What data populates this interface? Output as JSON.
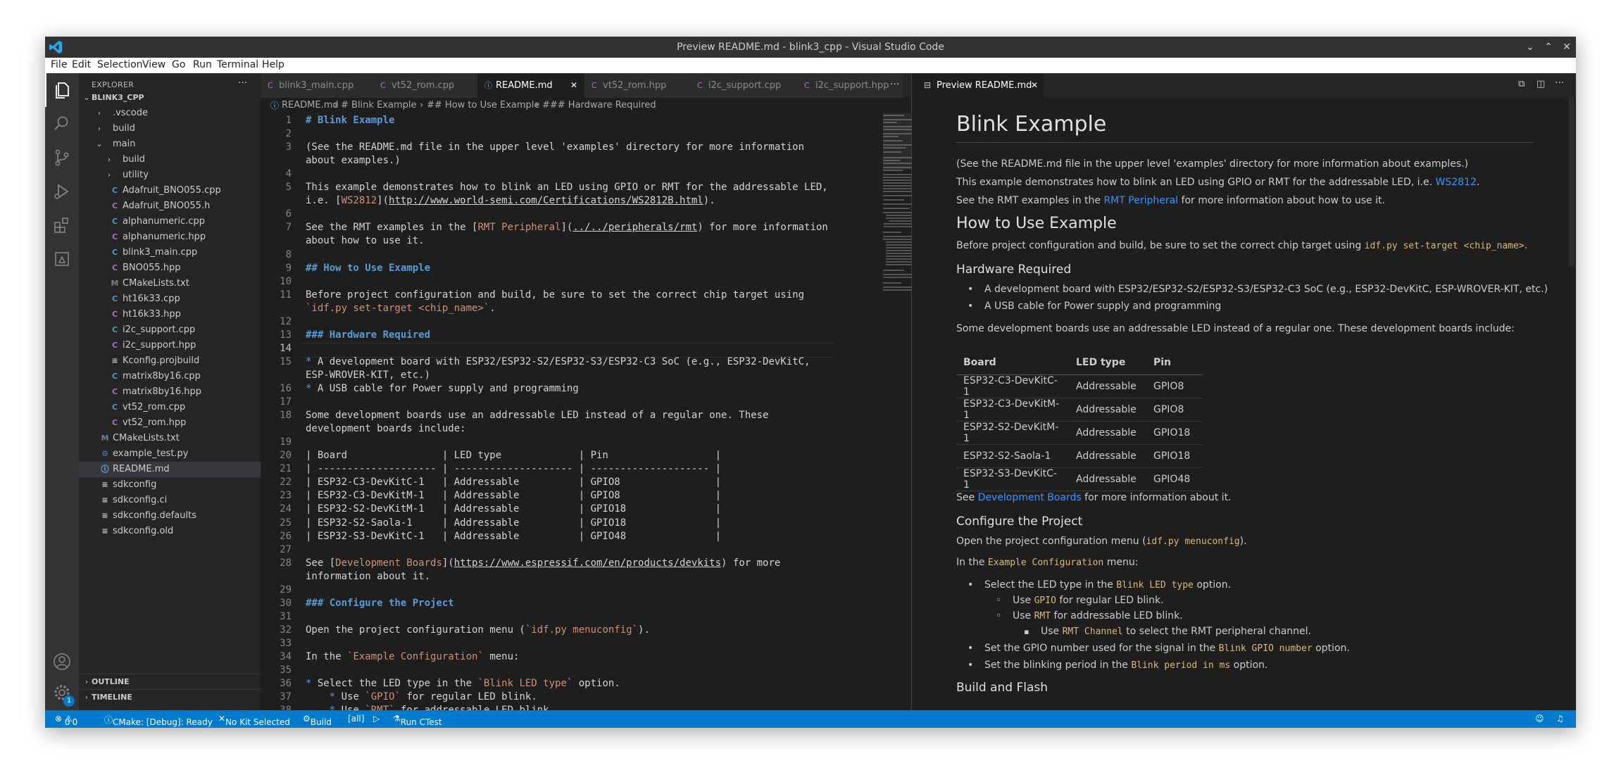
{
  "window": {
    "title": "Preview README.md - blink3_cpp - Visual Studio Code"
  },
  "menu": [
    "File",
    "Edit",
    "Selection",
    "View",
    "Go",
    "Run",
    "Terminal",
    "Help"
  ],
  "explorer": {
    "header": "EXPLORER",
    "root": "BLINK3_CPP",
    "items": [
      {
        "label": ".vscode",
        "type": "folder",
        "depth": 1,
        "open": false
      },
      {
        "label": "build",
        "type": "folder",
        "depth": 1,
        "open": false
      },
      {
        "label": "main",
        "type": "folder",
        "depth": 1,
        "open": true
      },
      {
        "label": "build",
        "type": "folder",
        "depth": 2,
        "open": false
      },
      {
        "label": "utility",
        "type": "folder",
        "depth": 2,
        "open": false
      },
      {
        "label": "Adafruit_BNO055.cpp",
        "type": "cpp",
        "depth": 2
      },
      {
        "label": "Adafruit_BNO055.h",
        "type": "h",
        "depth": 2
      },
      {
        "label": "alphanumeric.cpp",
        "type": "cpp",
        "depth": 2
      },
      {
        "label": "alphanumeric.hpp",
        "type": "hpp",
        "depth": 2
      },
      {
        "label": "blink3_main.cpp",
        "type": "cpp",
        "depth": 2
      },
      {
        "label": "BNO055.hpp",
        "type": "hpp",
        "depth": 2
      },
      {
        "label": "CMakeLists.txt",
        "type": "cmake",
        "depth": 2
      },
      {
        "label": "ht16k33.cpp",
        "type": "cpp",
        "depth": 2
      },
      {
        "label": "ht16k33.hpp",
        "type": "hpp",
        "depth": 2
      },
      {
        "label": "i2c_support.cpp",
        "type": "cpp",
        "depth": 2
      },
      {
        "label": "i2c_support.hpp",
        "type": "hpp",
        "depth": 2
      },
      {
        "label": "Kconfig.projbuild",
        "type": "text",
        "depth": 2
      },
      {
        "label": "matrix8by16.cpp",
        "type": "cpp",
        "depth": 2
      },
      {
        "label": "matrix8by16.hpp",
        "type": "hpp",
        "depth": 2
      },
      {
        "label": "vt52_rom.cpp",
        "type": "cpp",
        "depth": 2
      },
      {
        "label": "vt52_rom.hpp",
        "type": "hpp",
        "depth": 2
      },
      {
        "label": "CMakeLists.txt",
        "type": "cmake",
        "depth": 1
      },
      {
        "label": "example_test.py",
        "type": "py",
        "depth": 1
      },
      {
        "label": "README.md",
        "type": "info",
        "depth": 1,
        "selected": true
      },
      {
        "label": "sdkconfig",
        "type": "text",
        "depth": 1
      },
      {
        "label": "sdkconfig.ci",
        "type": "text",
        "depth": 1
      },
      {
        "label": "sdkconfig.defaults",
        "type": "text",
        "depth": 1
      },
      {
        "label": "sdkconfig.old",
        "type": "text",
        "depth": 1
      }
    ],
    "outline": "OUTLINE",
    "timeline": "TIMELINE"
  },
  "tabs": [
    {
      "label": "blink3_main.cpp",
      "icon": "C"
    },
    {
      "label": "vt52_rom.cpp",
      "icon": "C"
    },
    {
      "label": "README.md",
      "icon": "i",
      "active": true
    },
    {
      "label": "vt52_rom.hpp",
      "icon": "C"
    },
    {
      "label": "i2c_support.cpp",
      "icon": "C"
    },
    {
      "label": "i2c_support.hpp",
      "icon": "C"
    }
  ],
  "breadcrumb": [
    "README.md",
    "# Blink Example",
    "## How to Use Example",
    "### Hardware Required"
  ],
  "code": [
    {
      "n": "1",
      "segs": [
        {
          "t": "# Blink Example",
          "c": "h"
        }
      ]
    },
    {
      "n": "2",
      "segs": []
    },
    {
      "n": "3",
      "segs": [
        {
          "t": "(See the README.md file in the upper level 'examples' directory for more information",
          "c": "p"
        }
      ]
    },
    {
      "n": "",
      "segs": [
        {
          "t": "about examples.)",
          "c": "p"
        }
      ]
    },
    {
      "n": "4",
      "segs": []
    },
    {
      "n": "5",
      "segs": [
        {
          "t": "This example demonstrates how to blink an LED using GPIO or RMT for the addressable LED,",
          "c": "p"
        }
      ]
    },
    {
      "n": "",
      "segs": [
        {
          "t": "i.e. [",
          "c": "p"
        },
        {
          "t": "WS2812",
          "c": "lt"
        },
        {
          "t": "](",
          "c": "p"
        },
        {
          "t": "http://www.world-semi.com/Certifications/WS2812B.html",
          "c": "u"
        },
        {
          "t": ").",
          "c": "p"
        }
      ]
    },
    {
      "n": "6",
      "segs": []
    },
    {
      "n": "7",
      "segs": [
        {
          "t": "See the RMT examples in the [",
          "c": "p"
        },
        {
          "t": "RMT Peripheral",
          "c": "lt"
        },
        {
          "t": "](",
          "c": "p"
        },
        {
          "t": "../../peripherals/rmt",
          "c": "u"
        },
        {
          "t": ") for more information",
          "c": "p"
        }
      ]
    },
    {
      "n": "",
      "segs": [
        {
          "t": "about how to use it.",
          "c": "p"
        }
      ]
    },
    {
      "n": "8",
      "segs": []
    },
    {
      "n": "9",
      "segs": [
        {
          "t": "## How to Use Example",
          "c": "h"
        }
      ]
    },
    {
      "n": "10",
      "segs": []
    },
    {
      "n": "11",
      "segs": [
        {
          "t": "Before project configuration and build, be sure to set the correct chip target using",
          "c": "p"
        }
      ]
    },
    {
      "n": "",
      "segs": [
        {
          "t": "`idf.py set-target <chip_name>`",
          "c": "lt"
        },
        {
          "t": ".",
          "c": "p"
        }
      ]
    },
    {
      "n": "12",
      "segs": []
    },
    {
      "n": "13",
      "segs": [
        {
          "t": "### Hardware Required",
          "c": "h"
        }
      ]
    },
    {
      "n": "14",
      "segs": [],
      "cur": true
    },
    {
      "n": "15",
      "segs": [
        {
          "t": "*",
          "c": "b"
        },
        {
          "t": " A development board with ESP32/ESP32-S2/ESP32-S3/ESP32-C3 SoC (e.g., ESP32-DevKitC,",
          "c": "p"
        }
      ]
    },
    {
      "n": "",
      "segs": [
        {
          "t": "ESP-WROVER-KIT, etc.)",
          "c": "p"
        }
      ]
    },
    {
      "n": "16",
      "segs": [
        {
          "t": "*",
          "c": "b"
        },
        {
          "t": " A USB cable for Power supply and programming",
          "c": "p"
        }
      ]
    },
    {
      "n": "17",
      "segs": []
    },
    {
      "n": "18",
      "segs": [
        {
          "t": "Some development boards use an addressable LED instead of a regular one. These",
          "c": "p"
        }
      ]
    },
    {
      "n": "",
      "segs": [
        {
          "t": "development boards include:",
          "c": "p"
        }
      ]
    },
    {
      "n": "19",
      "segs": []
    },
    {
      "n": "20",
      "segs": [
        {
          "t": "| Board                | LED type             | Pin                  |",
          "c": "p"
        }
      ]
    },
    {
      "n": "21",
      "segs": [
        {
          "t": "| -------------------- | -------------------- | -------------------- |",
          "c": "p"
        }
      ]
    },
    {
      "n": "22",
      "segs": [
        {
          "t": "| ESP32-C3-DevKitC-1   | Addressable          | GPIO8                |",
          "c": "p"
        }
      ]
    },
    {
      "n": "23",
      "segs": [
        {
          "t": "| ESP32-C3-DevKitM-1   | Addressable          | GPIO8                |",
          "c": "p"
        }
      ]
    },
    {
      "n": "24",
      "segs": [
        {
          "t": "| ESP32-S2-DevKitM-1   | Addressable          | GPIO18               |",
          "c": "p"
        }
      ]
    },
    {
      "n": "25",
      "segs": [
        {
          "t": "| ESP32-S2-Saola-1     | Addressable          | GPIO18               |",
          "c": "p"
        }
      ]
    },
    {
      "n": "26",
      "segs": [
        {
          "t": "| ESP32-S3-DevKitC-1   | Addressable          | GPIO48               |",
          "c": "p"
        }
      ]
    },
    {
      "n": "27",
      "segs": []
    },
    {
      "n": "28",
      "segs": [
        {
          "t": "See [",
          "c": "p"
        },
        {
          "t": "Development Boards",
          "c": "lt"
        },
        {
          "t": "](",
          "c": "p"
        },
        {
          "t": "https://www.espressif.com/en/products/devkits",
          "c": "u"
        },
        {
          "t": ") for more",
          "c": "p"
        }
      ]
    },
    {
      "n": "",
      "segs": [
        {
          "t": "information about it.",
          "c": "p"
        }
      ]
    },
    {
      "n": "29",
      "segs": []
    },
    {
      "n": "30",
      "segs": [
        {
          "t": "### Configure the Project",
          "c": "h"
        }
      ]
    },
    {
      "n": "31",
      "segs": []
    },
    {
      "n": "32",
      "segs": [
        {
          "t": "Open the project configuration menu (",
          "c": "p"
        },
        {
          "t": "`idf.py menuconfig`",
          "c": "lt"
        },
        {
          "t": ").",
          "c": "p"
        }
      ]
    },
    {
      "n": "33",
      "segs": []
    },
    {
      "n": "34",
      "segs": [
        {
          "t": "In the ",
          "c": "p"
        },
        {
          "t": "`Example Configuration`",
          "c": "lt"
        },
        {
          "t": " menu:",
          "c": "p"
        }
      ]
    },
    {
      "n": "35",
      "segs": []
    },
    {
      "n": "36",
      "segs": [
        {
          "t": "*",
          "c": "b"
        },
        {
          "t": " Select the LED type in the ",
          "c": "p"
        },
        {
          "t": "`Blink LED type`",
          "c": "lt"
        },
        {
          "t": " option.",
          "c": "p"
        }
      ]
    },
    {
      "n": "37",
      "segs": [
        {
          "t": "    ",
          "c": "p"
        },
        {
          "t": "*",
          "c": "b"
        },
        {
          "t": " Use ",
          "c": "p"
        },
        {
          "t": "`GPIO`",
          "c": "lt"
        },
        {
          "t": " for regular LED blink.",
          "c": "p"
        }
      ]
    },
    {
      "n": "38",
      "segs": [
        {
          "t": "    ",
          "c": "p"
        },
        {
          "t": "*",
          "c": "b"
        },
        {
          "t": " Use ",
          "c": "p"
        },
        {
          "t": "`RMT`",
          "c": "lt"
        },
        {
          "t": " for addressable LED blink.",
          "c": "p"
        }
      ]
    }
  ],
  "preview": {
    "tab": "Preview README.md",
    "h1": "Blink Example",
    "p1": "(See the README.md file in the upper level 'examples' directory for more information about examples.)",
    "p2_pre": "This example demonstrates how to blink an LED using GPIO or RMT for the addressable LED, i.e.",
    "p2_link": "WS2812",
    "p2_post": ".",
    "p3_pre": "See the RMT examples in the",
    "p3_link": "RMT Peripheral",
    "p3_post": "for more information about how to use it.",
    "h2_howto": "How to Use Example",
    "p4_pre": "Before project configuration and build, be sure to set the correct chip target using",
    "p4_code": "idf.py set-target <chip_name>",
    "p4_post": ".",
    "h3_hw": "Hardware Required",
    "hw_items": [
      "A development board with ESP32/ESP32-S2/ESP32-S3/ESP32-C3 SoC (e.g., ESP32-DevKitC, ESP-WROVER-KIT, etc.)",
      "A USB cable for Power supply and programming"
    ],
    "p5": "Some development boards use an addressable LED instead of a regular one. These development boards include:",
    "table_headers": [
      "Board",
      "LED type",
      "Pin"
    ],
    "table_rows": [
      [
        "ESP32-C3-DevKitC-1",
        "Addressable",
        "GPIO8"
      ],
      [
        "ESP32-C3-DevKitM-1",
        "Addressable",
        "GPIO8"
      ],
      [
        "ESP32-S2-DevKitM-1",
        "Addressable",
        "GPIO18"
      ],
      [
        "ESP32-S2-Saola-1",
        "Addressable",
        "GPIO18"
      ],
      [
        "ESP32-S3-DevKitC-1",
        "Addressable",
        "GPIO48"
      ]
    ],
    "p6_pre": "See",
    "p6_link": "Development Boards",
    "p6_post": "for more information about it.",
    "h3_config": "Configure the Project",
    "p7_pre": "Open the project configuration menu (",
    "p7_code": "idf.py menuconfig",
    "p7_post": ").",
    "p8_pre": "In the",
    "p8_code": "Example Configuration",
    "p8_post": "menu:",
    "li1_pre": "Select the LED type in the",
    "li1_code": "Blink LED type",
    "li1_post": "option.",
    "li1a_pre": "Use",
    "li1a_code": "GPIO",
    "li1a_post": "for regular LED blink.",
    "li1b_pre": "Use",
    "li1b_code": "RMT",
    "li1b_post": "for addressable LED blink.",
    "li1b1_pre": "Use",
    "li1b1_code": "RMT Channel",
    "li1b1_post": "to select the RMT peripheral channel.",
    "li2_pre": "Set the GPIO number used for the signal in the",
    "li2_code": "Blink GPIO number",
    "li2_post": "option.",
    "li3_pre": "Set the blinking period in the",
    "li3_code": "Blink period in ms",
    "li3_post": "option.",
    "h3_build": "Build and Flash"
  },
  "status": {
    "errors": "0",
    "warnings": "0",
    "cmake": "CMake: [Debug]: Ready",
    "kit": "No Kit Selected",
    "build": "Build",
    "target": "[all]",
    "ctest": "Run CTest",
    "bell_count": "1"
  },
  "colors": {
    "accent": "#007acc",
    "heading": "#569cd6",
    "link": "#3794ff",
    "code": "#d7ba7d",
    "md_link_text": "#ce9178"
  }
}
